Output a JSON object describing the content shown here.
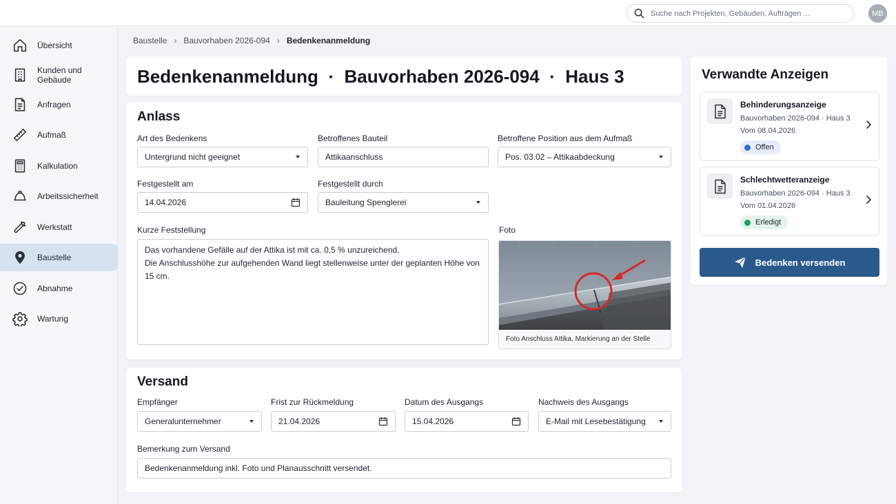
{
  "search": {
    "placeholder": "Suche nach Projekten, Gebäuden, Aufträgen ..."
  },
  "user": {
    "initials": "MB"
  },
  "sidebar": {
    "items": [
      {
        "label": "Übersicht",
        "icon": "home-icon"
      },
      {
        "label": "Kunden und Gebäude",
        "icon": "building-icon"
      },
      {
        "label": "Anfragen",
        "icon": "document-icon"
      },
      {
        "label": "Aufmaß",
        "icon": "ruler-icon"
      },
      {
        "label": "Kalkulation",
        "icon": "calculator-icon"
      },
      {
        "label": "Arbeitssicherheit",
        "icon": "hardhat-icon"
      },
      {
        "label": "Werkstatt",
        "icon": "wrench-icon"
      },
      {
        "label": "Baustelle",
        "icon": "map-pin-icon"
      },
      {
        "label": "Abnahme",
        "icon": "check-circle-icon"
      },
      {
        "label": "Wartung",
        "icon": "gear-icon"
      }
    ],
    "active": "Baustelle"
  },
  "breadcrumb": {
    "items": [
      "Baustelle",
      "Bauvorhaben 2026-094",
      "Bedenkenanmeldung"
    ]
  },
  "page": {
    "title": "Bedenkenanmeldung  ·  Bauvorhaben 2026-094  ·  Haus 3"
  },
  "anlass": {
    "title": "Anlass",
    "art_label": "Art des Bedenkens",
    "art_value": "Untergrund nicht geeignet",
    "bauteil_label": "Betroffenes Bauteil",
    "bauteil_value": "Attikaanschluss",
    "position_label": "Betroffene Position aus dem Aufmaß",
    "position_value": "Pos. 03.02 – Attikaabdeckung",
    "datum_label": "Festgestellt am",
    "datum_value": "14.04.2026",
    "durch_label": "Festgestellt durch",
    "durch_value": "Bauleitung Spenglerei",
    "feststellung_label": "Kurze Feststellung",
    "feststellung_line1": "Das vorhandene Gefälle auf der Attika ist mit ca. 0,5 % unzureichend.",
    "feststellung_line2": "Die Anschlusshöhe zur aufgehenden Wand liegt stellenweise unter der geplanten Höhe von 15 cm.",
    "foto_label": "Foto",
    "foto_caption": "Foto Anschluss Attika, Markierung an der Stelle"
  },
  "versand": {
    "title": "Versand",
    "empfaenger_label": "Empfänger",
    "empfaenger_value": "Generalunternehmer",
    "frist_label": "Frist zur Rückmeldung",
    "frist_value": "21.04.2026",
    "ausgang_label": "Datum des Ausgangs",
    "ausgang_value": "15.04.2026",
    "nachweis_label": "Nachweis des Ausgangs",
    "nachweis_value": "E-Mail mit Lesebestätigung",
    "bemerkung_label": "Bemerkung zum Versand",
    "bemerkung_value": "Bedenkenanmeldung inkl. Foto und Planausschnitt versendet."
  },
  "related": {
    "title": "Verwandte Anzeigen",
    "items": [
      {
        "name": "Behinderungsanzeige",
        "sub": "Bauvorhaben 2026-094 · Haus 3",
        "date": "Vom 08.04.2026",
        "status": "Offen",
        "status_color": "#2f6fd0",
        "badge_bg": "#e7eef9"
      },
      {
        "name": "Schlechtwetteranzeige",
        "sub": "Bauvorhaben 2026-094 · Haus 3",
        "date": "Vom 01.04.2026",
        "status": "Erledigt",
        "status_color": "#1f9d57",
        "badge_bg": "#e4f4ea"
      }
    ],
    "send_label": "Bedenken versenden"
  },
  "colors": {
    "primary": "#2a5a8c",
    "active_nav": "#d6e2f0"
  }
}
